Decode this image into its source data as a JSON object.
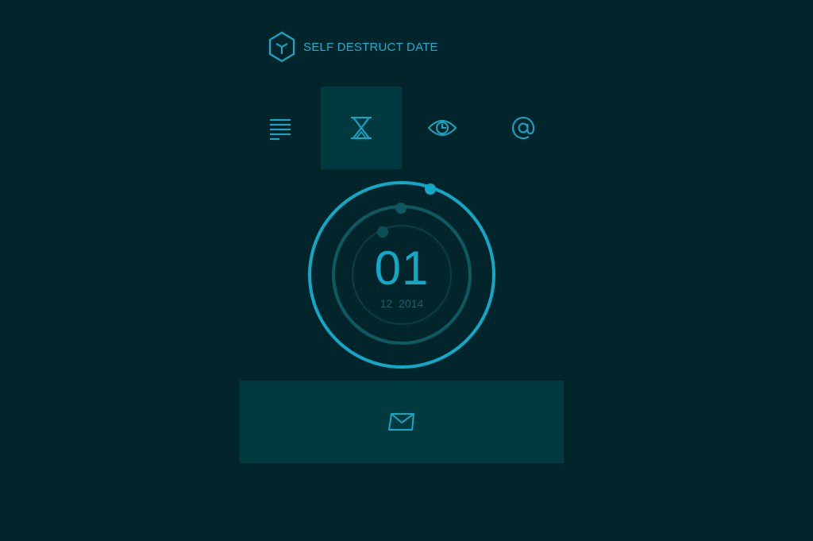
{
  "header": {
    "title": "SELF DESTRUCT DATE",
    "logo_icon": "cube-logo-icon"
  },
  "tabs": [
    {
      "icon": "text-lines-icon",
      "active": false
    },
    {
      "icon": "hourglass-icon",
      "active": true
    },
    {
      "icon": "eye-icon",
      "active": false
    },
    {
      "icon": "at-sign-icon",
      "active": false
    }
  ],
  "date_picker": {
    "day": "01",
    "month": "12",
    "year": "2014"
  },
  "send_button": {
    "icon": "envelope-icon"
  },
  "colors": {
    "background": "#02252c",
    "accent": "#11a9c8",
    "panel": "#00393e",
    "muted_ring": "#0d5a60"
  }
}
